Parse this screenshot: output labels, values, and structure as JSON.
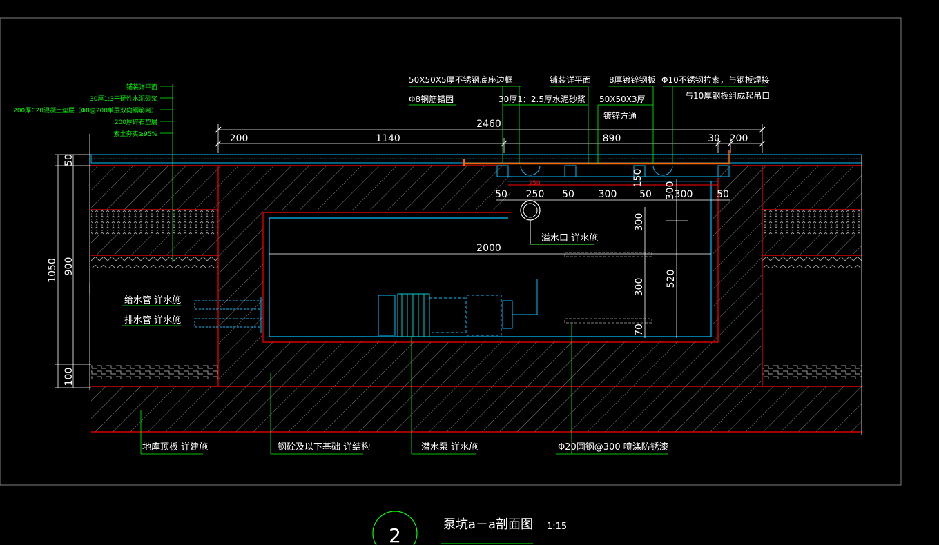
{
  "colors": {
    "background": "#000000",
    "frame": "#808080",
    "red": "#ff0000",
    "cyan": "#00bfff",
    "green": "#00ff00",
    "white": "#ffffff",
    "orange": "#ff6600",
    "hatch": "#7f7f7f"
  },
  "layers_left": [
    "铺装详平面",
    "30厚1:3干硬性水泥砂浆",
    "200厚C20混凝土垫层（Φ8@200单层双向钢筋网）",
    "200厚碎石垫层",
    "素土夯实≥95%"
  ],
  "notes_top": {
    "frame_edge": "50X50X5厚不锈钢底座边框",
    "paving": "铺装详平面",
    "galv_plate": "8厚镀锌钢板",
    "cable_1": "Φ10不锈钢拉索，与钢板焊接",
    "cable_2": "与10厚钢板组成起吊口",
    "anchor": "Φ8钢筋锚固",
    "mortar": "30厚1：2.5厚水泥砂浆",
    "square_tube_1": "50X50X3厚",
    "square_tube_2": "镀锌方通"
  },
  "dims_top": {
    "total": "2460",
    "d200_left": "200",
    "d1140": "1140",
    "d890": "890",
    "d30": "30",
    "d200_right": "200"
  },
  "dims_mid": {
    "d50a": "50",
    "d250": "250",
    "d250_small": "250",
    "d50b": "50",
    "d300a": "300",
    "d50c": "50",
    "d150": "150",
    "d300v": "300",
    "d300b": "300",
    "d50d": "50"
  },
  "dims_left": {
    "d50": "50",
    "d1050": "1050",
    "d900": "900",
    "d100": "100"
  },
  "dims_inner": {
    "width": "2000",
    "v300a": "300",
    "v300b": "300",
    "v70": "70",
    "v520": "520"
  },
  "labels": {
    "overflow": "溢水口 详水施",
    "supply": "给水管 详水施",
    "drain": "排水管 详水施",
    "roof_slab": "地库顶板 详建施",
    "foundation": "钢砼及以下基础 详结构",
    "pump": "潜水泵 详水施",
    "rebar": "Φ20圆钢@300 喷涤防锈漆"
  },
  "title": {
    "number": "2",
    "name": "泵坑a－a剖面图",
    "scale": "1:15"
  }
}
